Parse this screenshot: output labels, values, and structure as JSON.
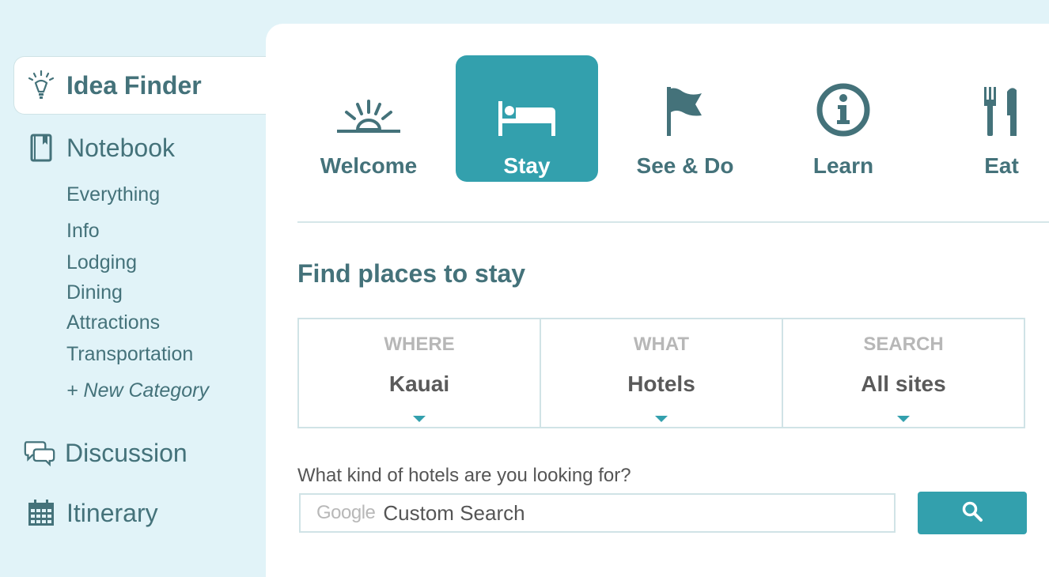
{
  "sidebar": {
    "idea_finder": "Idea Finder",
    "notebook": "Notebook",
    "notebook_items": [
      "Everything",
      "Info",
      "Lodging",
      "Dining",
      "Attractions",
      "Transportation"
    ],
    "new_category": "+ New Category",
    "discussion": "Discussion",
    "itinerary": "Itinerary"
  },
  "tabs": [
    {
      "label": "Welcome",
      "icon": "sunrise-icon",
      "active": false
    },
    {
      "label": "Stay",
      "icon": "bed-icon",
      "active": true
    },
    {
      "label": "See & Do",
      "icon": "flag-icon",
      "active": false
    },
    {
      "label": "Learn",
      "icon": "info-icon",
      "active": false
    },
    {
      "label": "Eat",
      "icon": "fork-knife-icon",
      "active": false
    }
  ],
  "main": {
    "title": "Find places to stay",
    "filters": [
      {
        "label": "WHERE",
        "value": "Kauai"
      },
      {
        "label": "WHAT",
        "value": "Hotels"
      },
      {
        "label": "SEARCH",
        "value": "All sites"
      }
    ],
    "question": "What kind of hotels are you looking for?",
    "search_brand": "Google",
    "search_placeholder": "Custom Search"
  },
  "colors": {
    "accent": "#33a0ad",
    "text": "#44727a",
    "sidebar_bg": "#e1f3f8"
  }
}
